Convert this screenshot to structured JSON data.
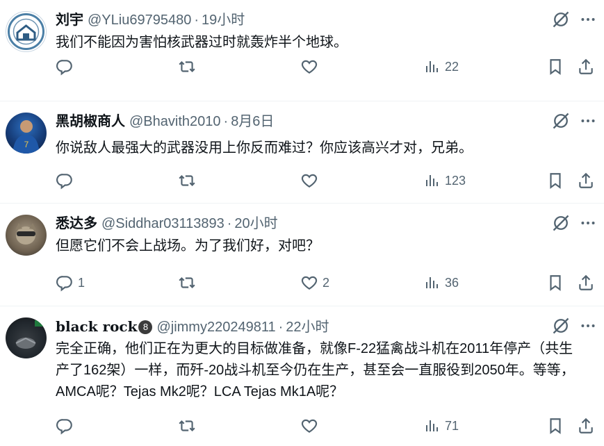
{
  "tweets": [
    {
      "name": "刘宇",
      "handle": "@YLiu69795480",
      "sep": "·",
      "time": "19小时",
      "text": "我们不能因为害怕核武器过时就轰炸半个地球。",
      "replies": "",
      "likes": "",
      "views": "22"
    },
    {
      "name": "黑胡椒商人",
      "handle": "@Bhavith2010",
      "sep": "·",
      "time": "8月6日",
      "text": "你说敌人最强大的武器没用上你反而难过？你应该高兴才对，兄弟。",
      "replies": "",
      "likes": "",
      "views": "123"
    },
    {
      "name": "悉达多",
      "handle": "@Siddhar03113893",
      "sep": "·",
      "time": "20小时",
      "text": "但愿它们不会上战场。为了我们好，对吧？",
      "replies": "1",
      "likes": "2",
      "views": "36"
    },
    {
      "name": "black rock",
      "badge": "8",
      "handle": "@jimmy220249811",
      "sep": "·",
      "time": "22小时",
      "text": "完全正确，他们正在为更大的目标做准备，就像F-22猛禽战斗机在2011年停产（共生产了162架）一样，而歼-20战斗机至今仍在生产，甚至会一直服役到2050年。等等，AMCA呢？Tejas Mk2呢？LCA Tejas Mk1A呢？",
      "replies": "",
      "likes": "",
      "views": "71"
    }
  ],
  "colors": {
    "text": "#0f1419",
    "muted": "#536471",
    "divider": "#eff3f4"
  },
  "icons": [
    "grok-icon",
    "more-icon",
    "reply-icon",
    "retweet-icon",
    "like-icon",
    "views-icon",
    "bookmark-icon",
    "share-icon"
  ]
}
